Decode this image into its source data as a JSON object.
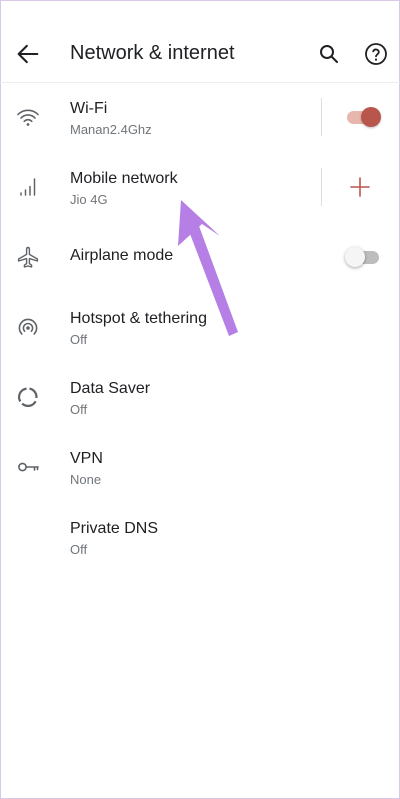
{
  "appbar": {
    "title": "Network & internet",
    "back_icon": "arrow-left-icon",
    "search_icon": "search-icon",
    "help_icon": "help-circle-icon"
  },
  "items": [
    {
      "label": "Wi-Fi",
      "sub": "Manan2.4Ghz",
      "icon": "wifi-icon",
      "control": "toggle",
      "toggle_on": true
    },
    {
      "label": "Mobile network",
      "sub": "Jio 4G",
      "icon": "signal-bars-icon",
      "control": "add"
    },
    {
      "label": "Airplane mode",
      "sub": "",
      "icon": "airplane-icon",
      "control": "toggle",
      "toggle_on": false
    },
    {
      "label": "Hotspot & tethering",
      "sub": "Off",
      "icon": "hotspot-icon"
    },
    {
      "label": "Data Saver",
      "sub": "Off",
      "icon": "data-saver-icon"
    },
    {
      "label": "VPN",
      "sub": "None",
      "icon": "key-icon"
    },
    {
      "label": "Private DNS",
      "sub": "Off",
      "icon": ""
    }
  ],
  "colors": {
    "toggle_on_thumb": "#b8564b",
    "toggle_on_track": "#e7b6ad",
    "add_plus": "#b8564b",
    "annotation_arrow": "#b57fe6"
  }
}
